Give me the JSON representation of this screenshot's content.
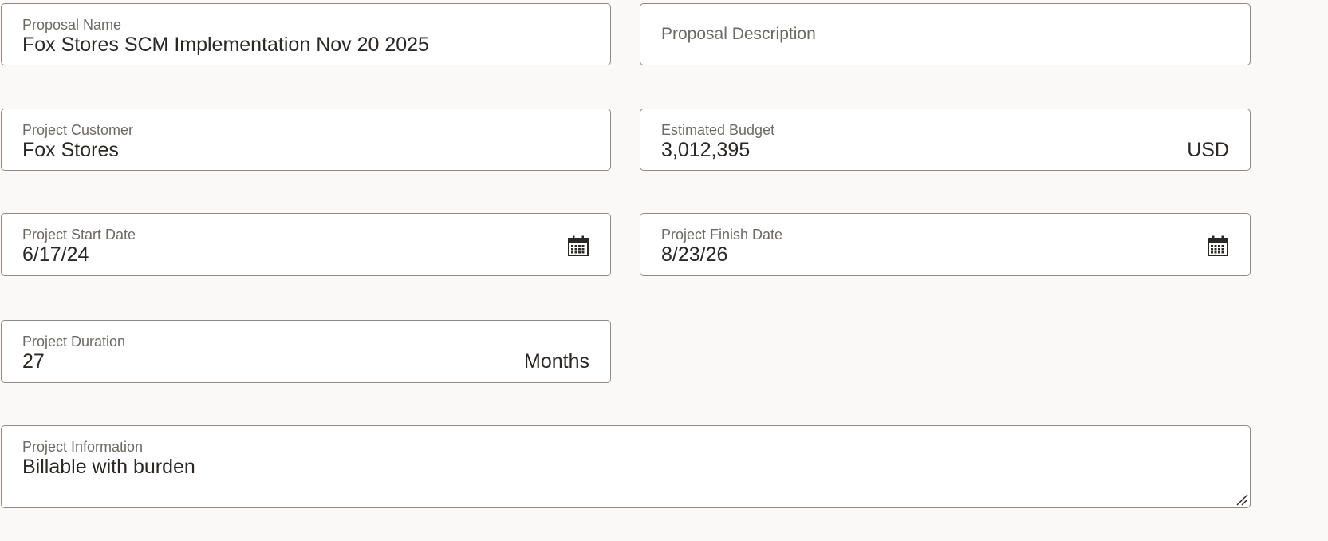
{
  "form": {
    "proposal_name": {
      "label": "Proposal Name",
      "value": "Fox Stores SCM Implementation Nov 20 2025"
    },
    "proposal_description": {
      "placeholder": "Proposal Description"
    },
    "project_customer": {
      "label": "Project Customer",
      "value": "Fox Stores"
    },
    "estimated_budget": {
      "label": "Estimated Budget",
      "value": "3,012,395",
      "currency": "USD"
    },
    "project_start_date": {
      "label": "Project Start Date",
      "value": "6/17/24",
      "icon": "calendar-icon"
    },
    "project_finish_date": {
      "label": "Project Finish Date",
      "value": "8/23/26",
      "icon": "calendar-icon"
    },
    "project_duration": {
      "label": "Project Duration",
      "value": "27",
      "unit": "Months"
    },
    "project_information": {
      "label": "Project Information",
      "value": "Billable with burden"
    }
  },
  "colors": {
    "background": "#fbf9f8",
    "field_border": "#8f8a86",
    "label_text": "#6d6965",
    "value_text": "#2a2725"
  }
}
